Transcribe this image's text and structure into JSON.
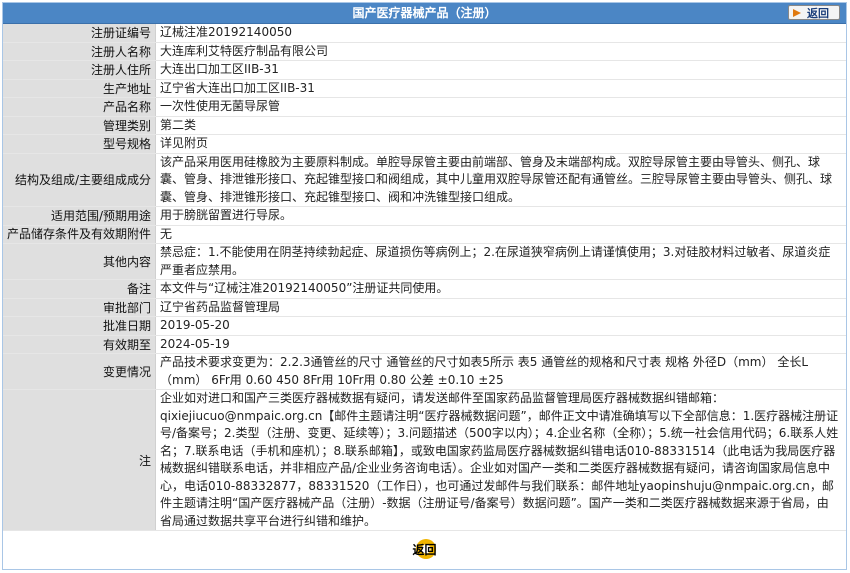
{
  "header": {
    "title": "国产医疗器械产品（注册）",
    "back_label": "返回"
  },
  "fields": [
    {
      "label": "注册证编号",
      "value": "辽械注准20192140050"
    },
    {
      "label": "注册人名称",
      "value": "大连库利艾特医疗制品有限公司"
    },
    {
      "label": "注册人住所",
      "value": "大连出口加工区IIB-31"
    },
    {
      "label": "生产地址",
      "value": "辽宁省大连出口加工区IIB-31"
    },
    {
      "label": "产品名称",
      "value": "一次性使用无菌导尿管"
    },
    {
      "label": "管理类别",
      "value": "第二类"
    },
    {
      "label": "型号规格",
      "value": "详见附页"
    },
    {
      "label": "结构及组成/主要组成成分",
      "value": "该产品采用医用硅橡胶为主要原料制成。单腔导尿管主要由前端部、管身及末端部构成。双腔导尿管主要由导管头、侧孔、球囊、管身、排泄锥形接口、充起锥型接口和阀组成，其中儿童用双腔导尿管还配有通管丝。三腔导尿管主要由导管头、侧孔、球囊、管身、排泄锥形接口、充起锥型接口、阀和冲洗锥型接口组成。"
    },
    {
      "label": "适用范围/预期用途",
      "value": "用于膀胱留置进行导尿。"
    },
    {
      "label": "产品储存条件及有效期附件",
      "value": "无"
    },
    {
      "label": "其他内容",
      "value": "禁忌症：1.不能使用在阴茎持续勃起症、尿道损伤等病例上；2.在尿道狭窄病例上请谨慎使用；3.对硅胶材料过敏者、尿道炎症严重者应禁用。"
    },
    {
      "label": "备注",
      "value": "本文件与“辽械注准20192140050”注册证共同使用。"
    },
    {
      "label": "审批部门",
      "value": "辽宁省药品监督管理局"
    },
    {
      "label": "批准日期",
      "value": "2019-05-20"
    },
    {
      "label": "有效期至",
      "value": "2024-05-19"
    },
    {
      "label": "变更情况",
      "value": "产品技术要求变更为：2.2.3通管丝的尺寸 通管丝的尺寸如表5所示 表5 通管丝的规格和尺寸表 规格 外径D（mm） 全长L（mm） 6Fr用 0.60 450 8Fr用 10Fr用 0.80 公差 ±0.10 ±25"
    },
    {
      "label": "注",
      "value": "企业如对进口和国产三类医疗器械数据有疑问，请发送邮件至国家药品监督管理局医疗器械数据纠错邮箱：qixiejiucuo@nmpaic.org.cn【邮件主题请注明“医疗器械数据问题”，邮件正文中请准确填写以下全部信息：1.医疗器械注册证号/备案号；2.类型（注册、变更、延续等）；3.问题描述（500字以内）；4.企业名称（全称）；5.统一社会信用代码；6.联系人姓名；7.联系电话（手机和座机）；8.联系邮箱】，或致电国家药监局医疗器械数据纠错电话010-88331514（此电话为我局医疗器械数据纠错联系电话，并非相应产品/企业业务咨询电话）。企业如对国产一类和二类医疗器械数据有疑问，请咨询国家局信息中心，电话010-88332877，88331520（工作日），也可通过发邮件与我们联系：邮件地址yaopinshuju@nmpaic.org.cn，邮件主题请注明“国产医疗器械产品（注册）-数据（注册证号/备案号）数据问题”。国产一类和二类医疗器械数据来源于省局，由省局通过数据共享平台进行纠错和维护。"
    }
  ],
  "footer": {
    "back_label": "返回"
  }
}
